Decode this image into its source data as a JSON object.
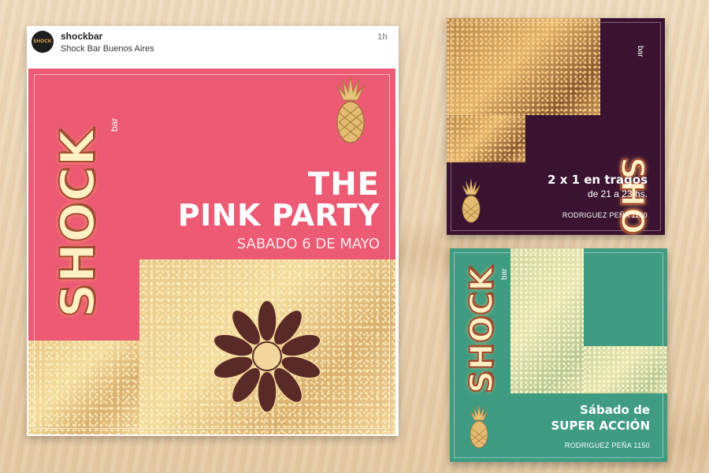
{
  "post": {
    "avatar_text": "SHOCK",
    "account": "shockbar",
    "location": "Shock Bar Buenos Aires",
    "time": "1h"
  },
  "pink_party": {
    "logo_main": "SHOCK",
    "logo_sub": "bar",
    "title_line1": "THE",
    "title_line2": "PINK PARTY",
    "date": "SABADO 6 DE MAYO"
  },
  "promo_drinks": {
    "logo_main": "SHOCK",
    "logo_sub": "bar",
    "title": "2 x 1 en tragos",
    "subtitle": "de 21 a 23 hs.",
    "address": "RODRIGUEZ PEÑA 1150"
  },
  "promo_action": {
    "logo_main": "SHOCK",
    "logo_sub": "bar",
    "title_line1": "Sábado de",
    "title_line2": "SUPER ACCIÓN",
    "address": "RODRIGUEZ PEÑA 1150"
  },
  "colors": {
    "pink": "#ec5a73",
    "purple": "#3a1330",
    "green": "#3f9b82",
    "gold": "#e8c98a"
  },
  "icons": [
    "pineapple-icon",
    "mandala-icon"
  ]
}
